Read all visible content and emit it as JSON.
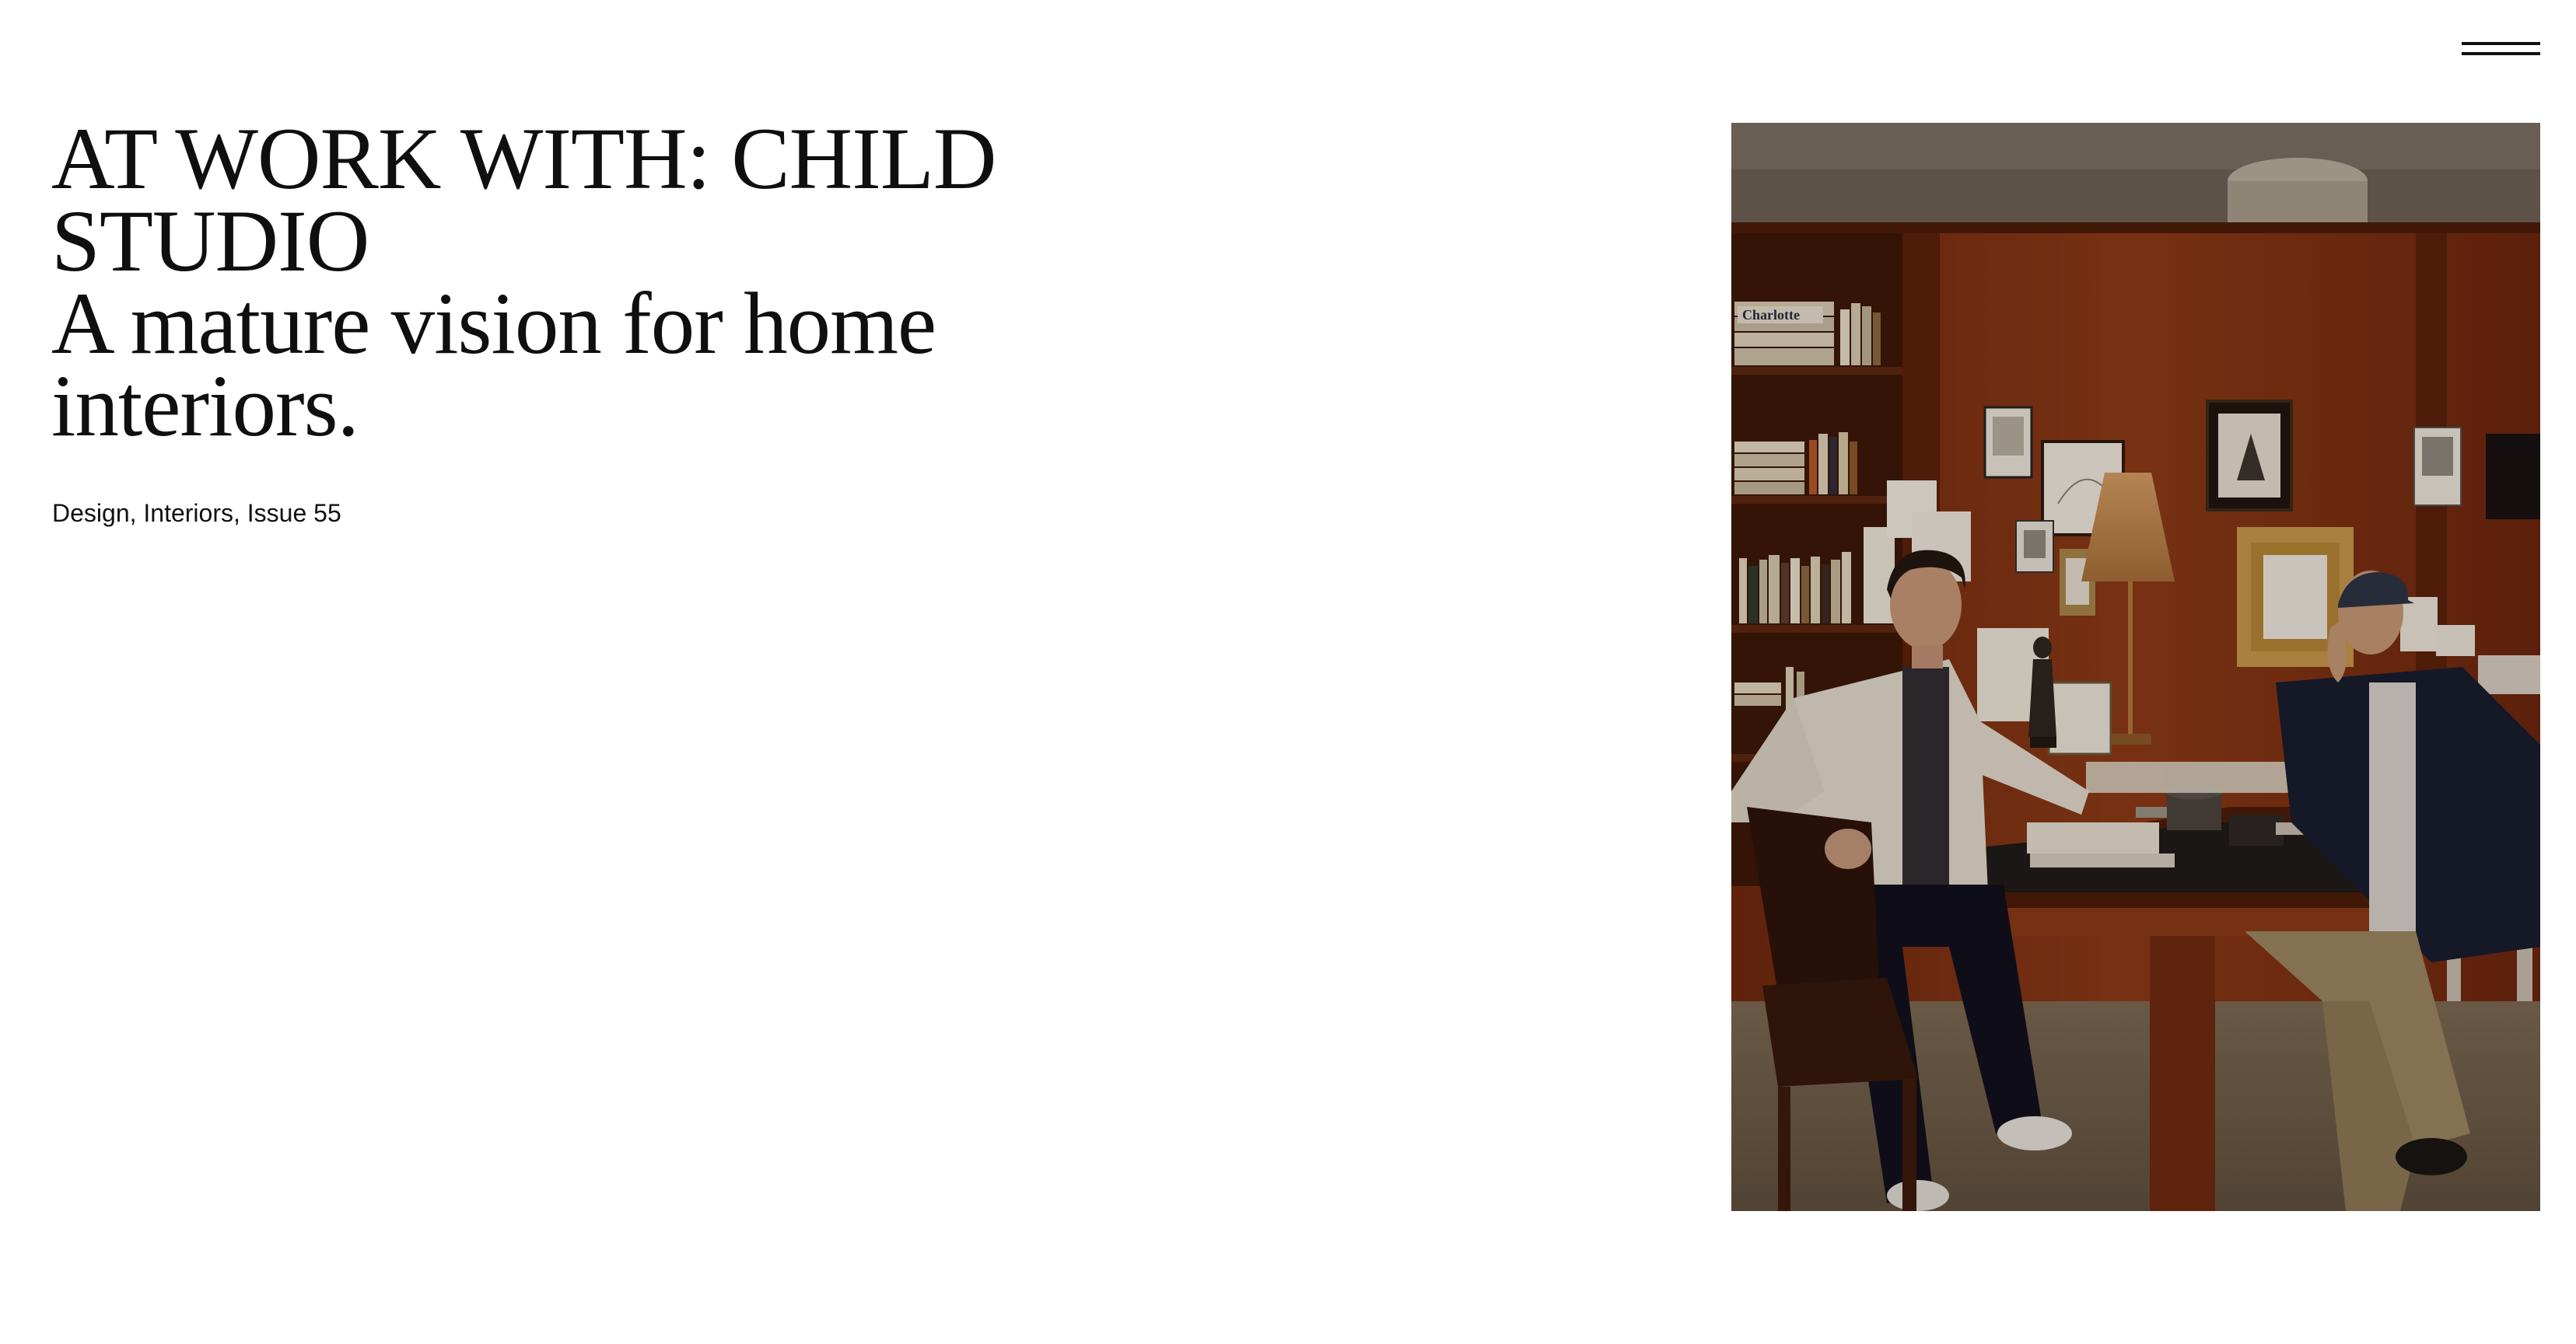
{
  "menu": {
    "icon": "hamburger-menu-icon"
  },
  "article": {
    "title": "AT WORK WITH: CHILD STUDIO",
    "subtitle": "A mature vision for home interiors.",
    "tags": "Design, Interiors, Issue 55"
  },
  "photo": {
    "book_spine_label": "Charlotte"
  },
  "colors": {
    "background": "#ffffff",
    "text": "#0f0f0f",
    "wood": "#7a2f12"
  }
}
